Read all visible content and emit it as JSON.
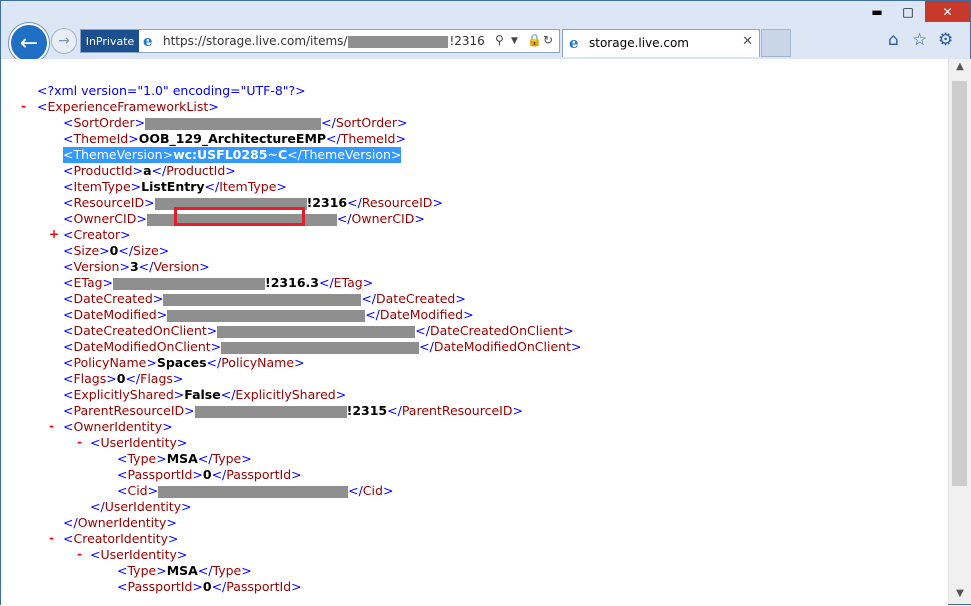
{
  "window": {
    "min_glyph": "▬",
    "max_glyph": "□",
    "close_glyph": "✕"
  },
  "nav": {
    "inprivate": "InPrivate",
    "url_prefix": "https://storage.live.com/items/",
    "url_suffix": "!2316",
    "tab_title": "storage.live.com"
  },
  "xml": {
    "declaration": "<?xml version=\"1.0\" encoding=\"UTF-8\"?>",
    "root": "ExperienceFrameworkList",
    "theme_id_value": "OOB_129_ArchitectureEMP",
    "theme_version_value": "wc:USFL0285~C",
    "product_id_value": "a",
    "item_type_value": "ListEntry",
    "resource_id_suffix": "!2316",
    "size_value": "0",
    "version_value": "3",
    "etag_suffix": "!2316.3",
    "policy_name_value": "Spaces",
    "flags_value": "0",
    "explicitly_shared_value": "False",
    "parent_resource_id_suffix": "!2315",
    "owner_type_value": "MSA",
    "owner_passport_value": "0",
    "creator_type_value": "MSA",
    "creator_passport_value": "0"
  }
}
